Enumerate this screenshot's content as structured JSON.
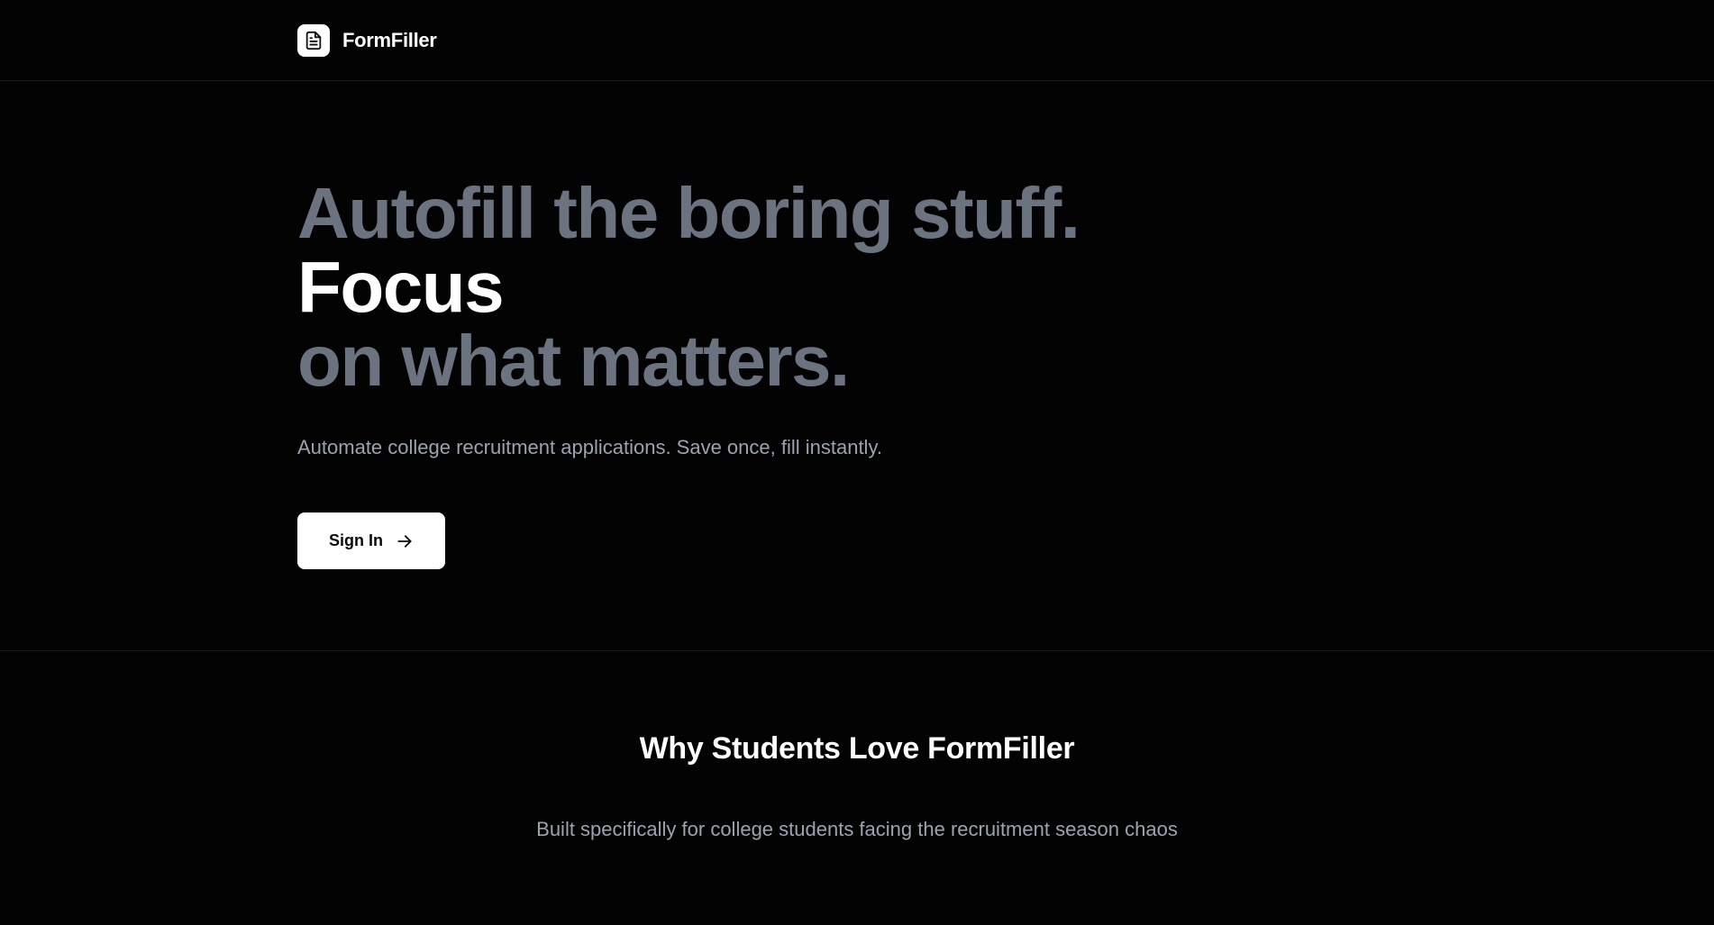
{
  "header": {
    "brand_name": "FormFiller",
    "logo_icon": "document-icon"
  },
  "hero": {
    "headline_line1": "Autofill the boring stuff.",
    "headline_line2": "Focus",
    "headline_line3": "on what matters.",
    "subtitle": "Automate college recruitment applications. Save once, fill instantly.",
    "cta_label": "Sign In",
    "cta_icon": "arrow-right-icon"
  },
  "features": {
    "title": "Why Students Love FormFiller",
    "subtitle": "Built specifically for college students facing the recruitment season chaos"
  },
  "colors": {
    "background": "#030303",
    "muted_heading": "#6b7280",
    "muted_text": "#9ca3af",
    "primary": "#ffffff"
  }
}
